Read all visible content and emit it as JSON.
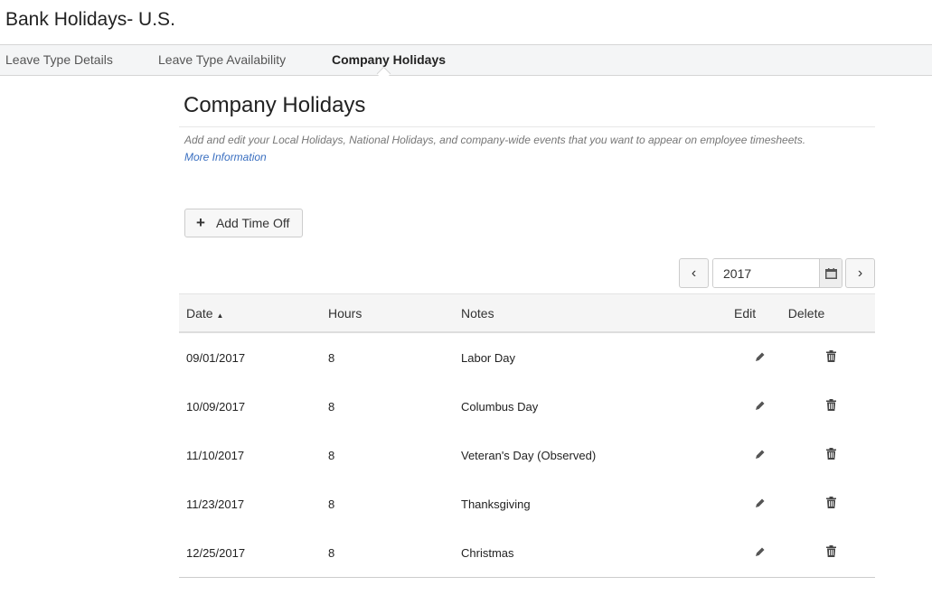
{
  "page_title": "Bank Holidays- U.S.",
  "tabs": [
    {
      "label": "Leave Type Details"
    },
    {
      "label": "Leave Type Availability"
    },
    {
      "label": "Company Holidays",
      "active": true
    }
  ],
  "section": {
    "title": "Company Holidays",
    "description": "Add and edit your Local Holidays, National Holidays, and company-wide events that you want to appear on employee timesheets.",
    "more_link": "More Information"
  },
  "add_button": "Add Time Off",
  "year_picker": {
    "value": "2017"
  },
  "table": {
    "headers": {
      "date": "Date",
      "hours": "Hours",
      "notes": "Notes",
      "edit": "Edit",
      "delete": "Delete"
    },
    "rows": [
      {
        "date": "09/01/2017",
        "hours": "8",
        "notes": "Labor Day"
      },
      {
        "date": "10/09/2017",
        "hours": "8",
        "notes": "Columbus Day"
      },
      {
        "date": "11/10/2017",
        "hours": "8",
        "notes": "Veteran's Day (Observed)"
      },
      {
        "date": "11/23/2017",
        "hours": "8",
        "notes": "Thanksgiving"
      },
      {
        "date": "12/25/2017",
        "hours": "8",
        "notes": "Christmas"
      }
    ]
  },
  "colors": {
    "link": "#3a6fc0",
    "tab_bar": "#f4f5f6"
  }
}
